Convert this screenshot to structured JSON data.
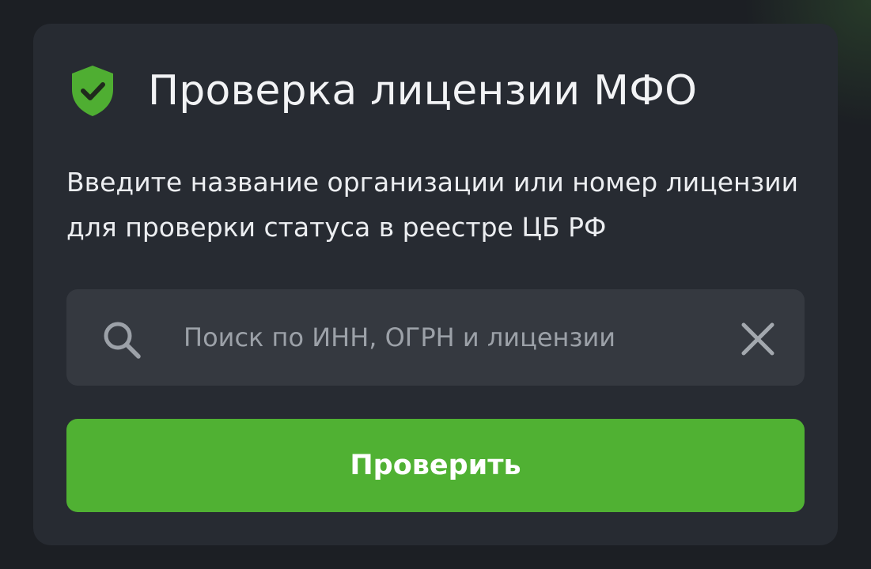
{
  "card": {
    "title": "Проверка лицензии МФО",
    "description": "Введите название организации или номер лицензии для проверки статуса в реестре ЦБ РФ",
    "icon": "shield-check-icon"
  },
  "search": {
    "value": "",
    "placeholder": "Поиск по ИНН, ОГРН и лицензии",
    "search_icon": "search-icon",
    "clear_icon": "close-icon"
  },
  "button": {
    "label": "Проверить"
  },
  "colors": {
    "accent": "#50b133",
    "card_bg": "#272b32",
    "page_bg": "#1c1f24",
    "input_bg": "#353940"
  }
}
